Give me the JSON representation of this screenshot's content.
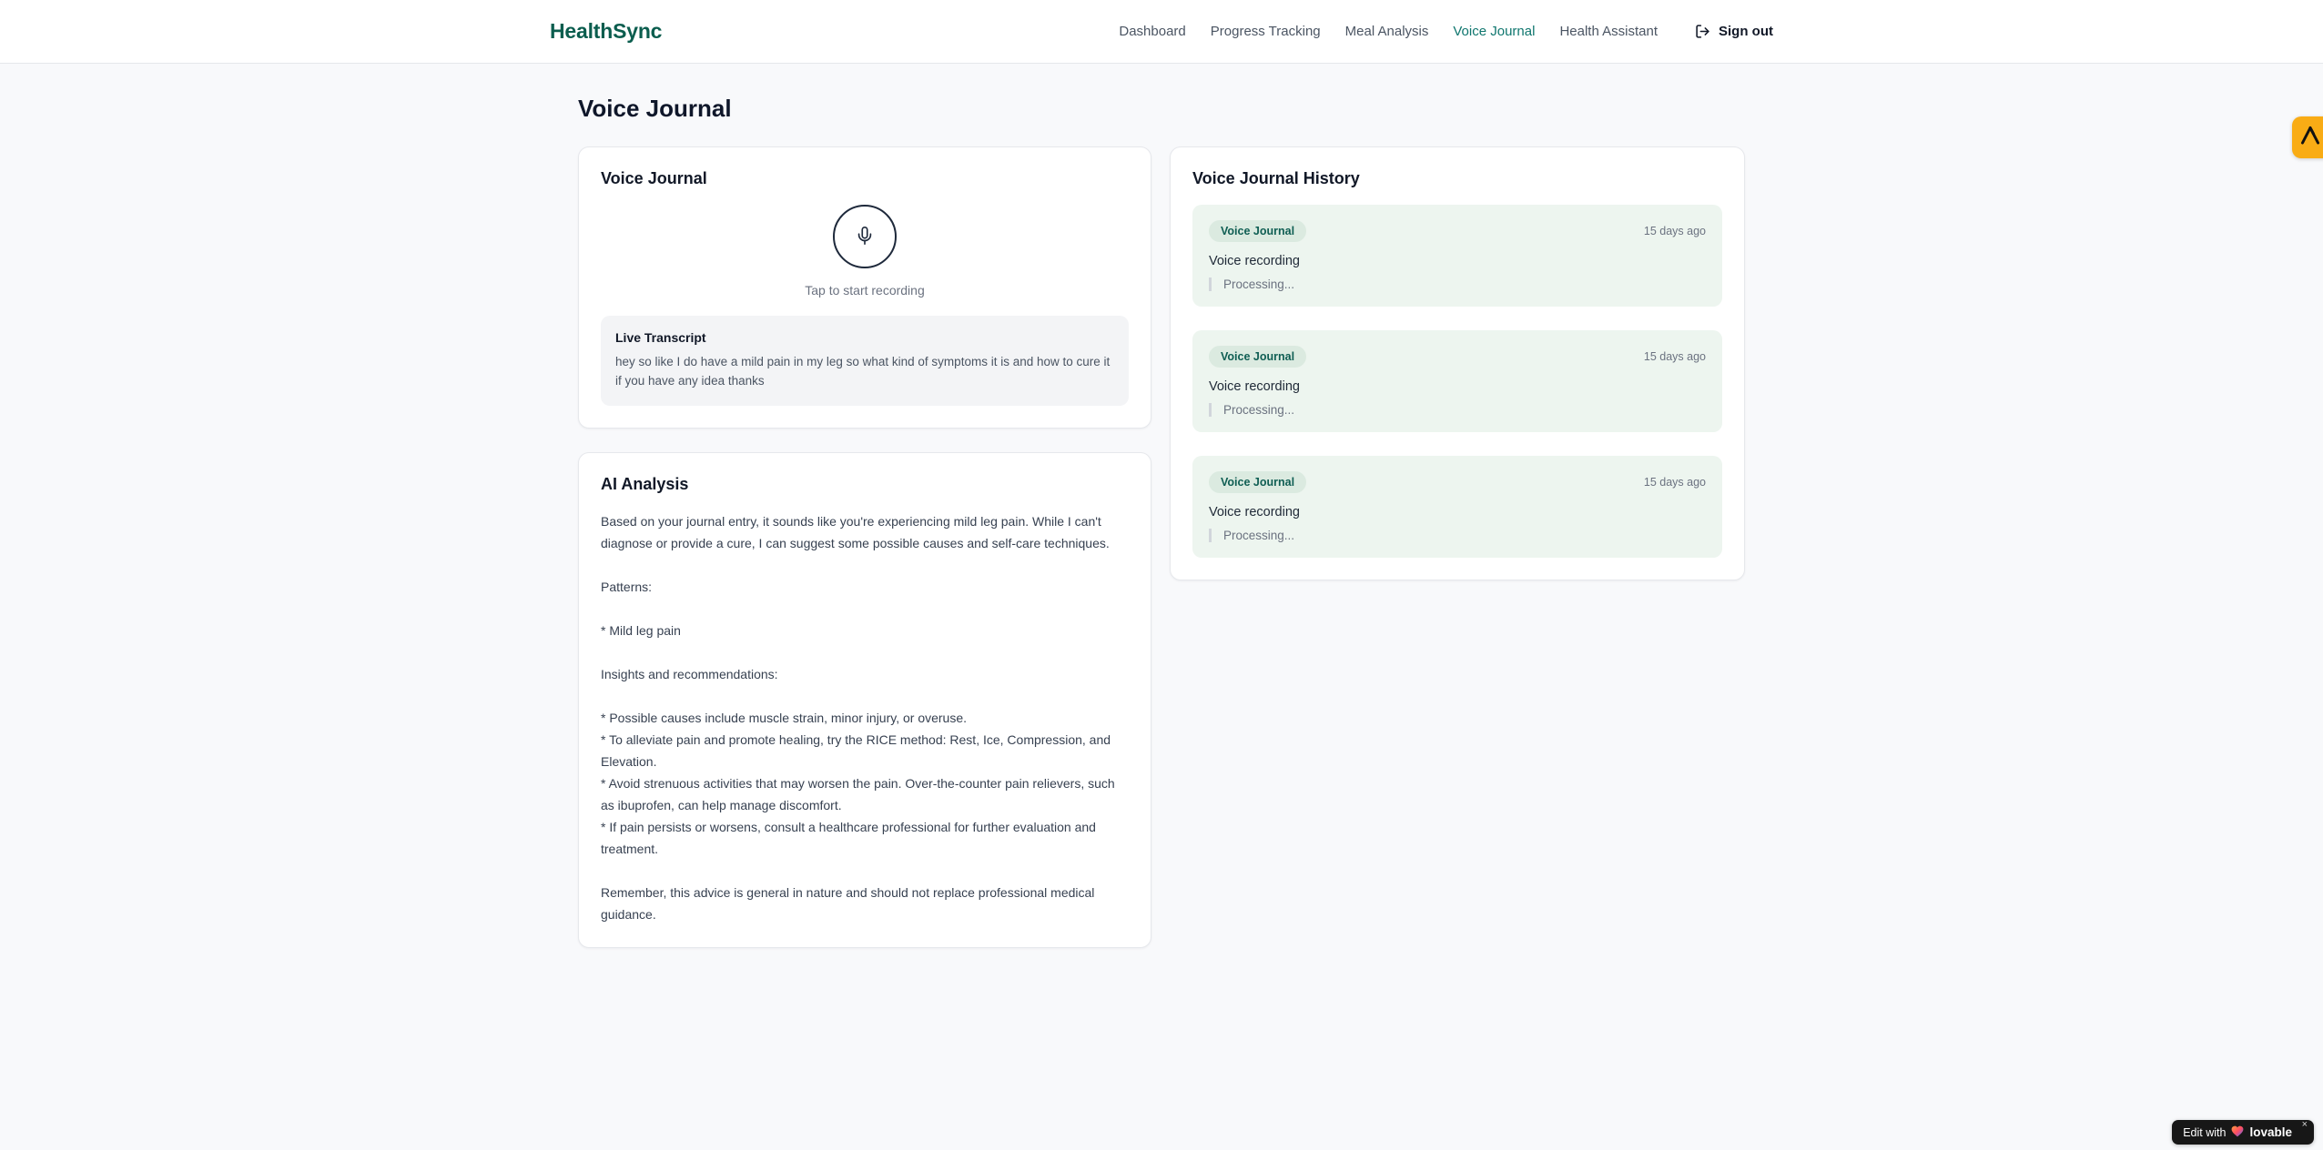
{
  "header": {
    "logo": "HealthSync",
    "nav": [
      {
        "label": "Dashboard",
        "active": false
      },
      {
        "label": "Progress Tracking",
        "active": false
      },
      {
        "label": "Meal Analysis",
        "active": false
      },
      {
        "label": "Voice Journal",
        "active": true
      },
      {
        "label": "Health Assistant",
        "active": false
      }
    ],
    "sign_out_label": "Sign out"
  },
  "page": {
    "title": "Voice Journal"
  },
  "recorder_card": {
    "title": "Voice Journal",
    "tap_hint": "Tap to start recording",
    "transcript_title": "Live Transcript",
    "transcript_text": "hey so like I do have a mild pain in my leg so what kind of symptoms it is and how to cure it if you have any idea thanks"
  },
  "analysis_card": {
    "title": "AI Analysis",
    "body": "Based on your journal entry, it sounds like you're experiencing mild leg pain. While I can't diagnose or provide a cure, I can suggest some possible causes and self-care techniques.\n\nPatterns:\n\n* Mild leg pain\n\nInsights and recommendations:\n\n* Possible causes include muscle strain, minor injury, or overuse.\n* To alleviate pain and promote healing, try the RICE method: Rest, Ice, Compression, and Elevation.\n* Avoid strenuous activities that may worsen the pain. Over-the-counter pain relievers, such as ibuprofen, can help manage discomfort.\n* If pain persists or worsens, consult a healthcare professional for further evaluation and treatment.\n\nRemember, this advice is general in nature and should not replace professional medical guidance."
  },
  "history_card": {
    "title": "Voice Journal History",
    "entries": [
      {
        "badge": "Voice Journal",
        "time": "15 days ago",
        "description": "Voice recording",
        "status": "Processing..."
      },
      {
        "badge": "Voice Journal",
        "time": "15 days ago",
        "description": "Voice recording",
        "status": "Processing..."
      },
      {
        "badge": "Voice Journal",
        "time": "15 days ago",
        "description": "Voice recording",
        "status": "Processing..."
      }
    ]
  },
  "overlays": {
    "edit_badge": {
      "prefix": "Edit with",
      "brand": "lovable",
      "close": "×"
    },
    "side_badge": {
      "icon": "brand-monogram-icon"
    }
  },
  "colors": {
    "brand_logo": "#0b5d4e",
    "nav_active": "#0f766e",
    "page_bg": "#f8f9fb",
    "entry_bg": "#edf5ef",
    "badge_bg": "#dbeae0",
    "badge_text": "#0f5e53",
    "side_badge_bg": "#f9ac15",
    "edit_badge_bg": "#171717"
  }
}
